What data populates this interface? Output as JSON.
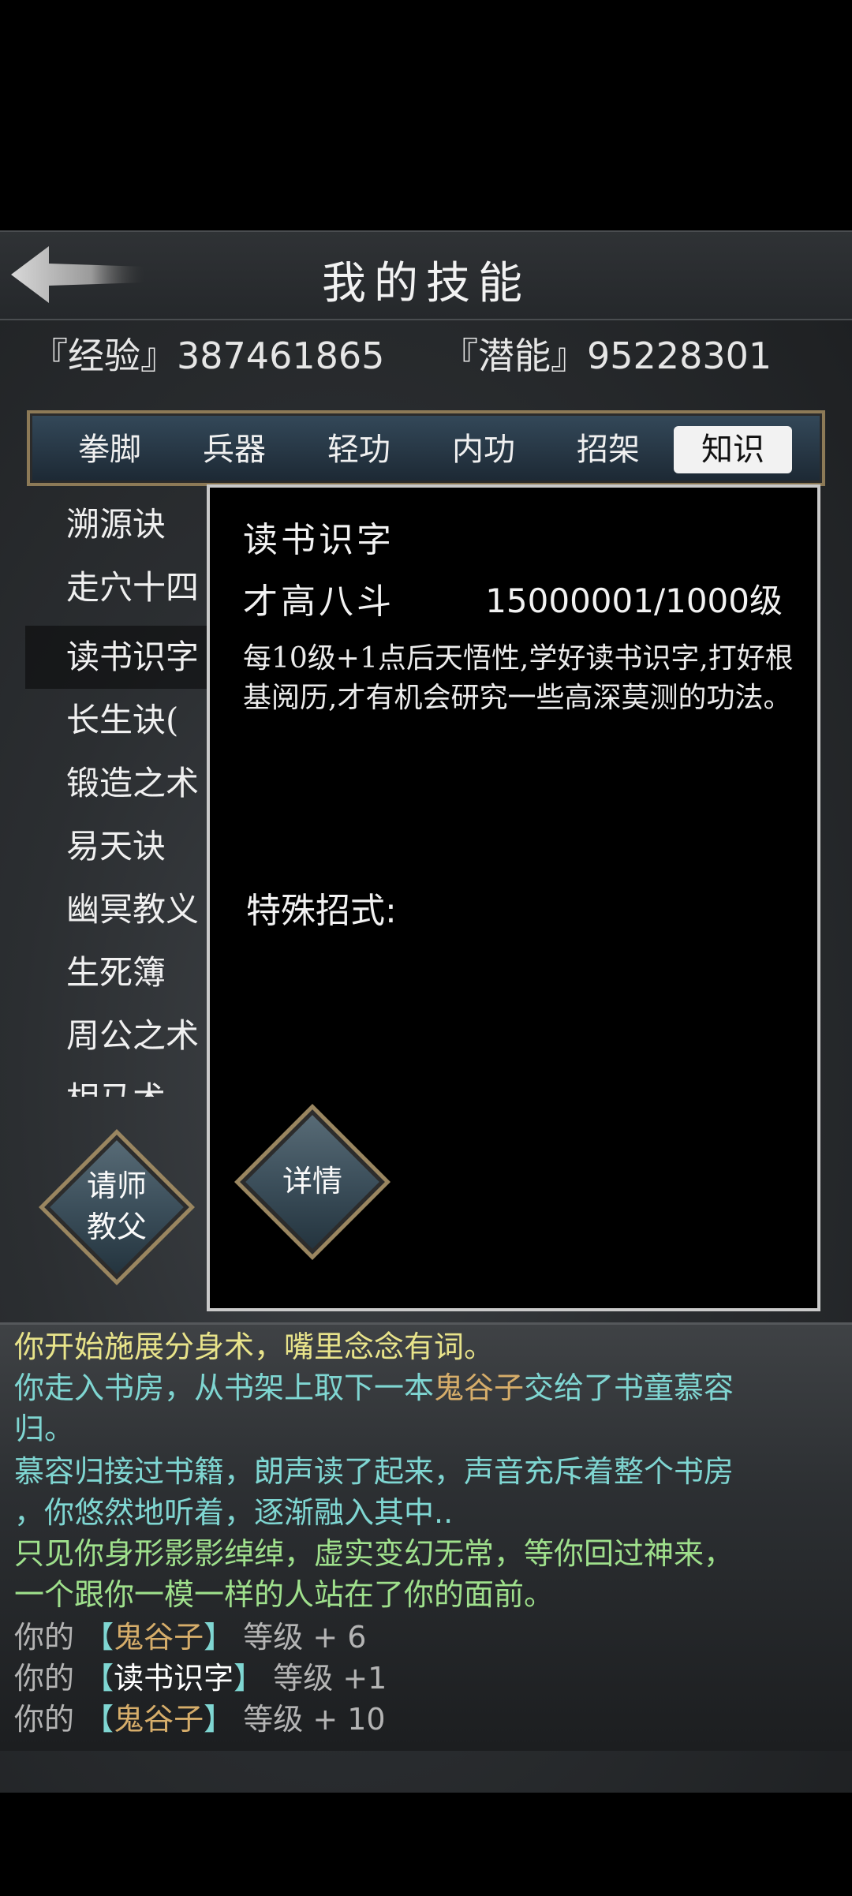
{
  "header": {
    "title": "我的技能",
    "back_icon": "back-arrow-icon"
  },
  "stats": {
    "exp": "『经验』387461865",
    "potential": "『潜能』95228301"
  },
  "tabs": [
    {
      "label": "拳脚",
      "active": false
    },
    {
      "label": "兵器",
      "active": false
    },
    {
      "label": "轻功",
      "active": false
    },
    {
      "label": "内功",
      "active": false
    },
    {
      "label": "招架",
      "active": false
    },
    {
      "label": "知识",
      "active": true
    }
  ],
  "skills": [
    {
      "label": "溯源诀"
    },
    {
      "label": "走穴十四"
    },
    {
      "label": "读书识字",
      "selected": true
    },
    {
      "label": "长生诀("
    },
    {
      "label": "锻造之术"
    },
    {
      "label": "易天诀"
    },
    {
      "label": "幽冥教义"
    },
    {
      "label": "生死簿"
    },
    {
      "label": "周公之术"
    },
    {
      "label": "相马术"
    }
  ],
  "detail": {
    "name": "读书识字",
    "rank": "才高八斗",
    "level": "15000001/1000级",
    "description": "每10级+1点后天悟性,学好读书识字,打好根基阅历,才有机会研究一些高深莫测的功法。",
    "special_label": "特殊招式:",
    "details_button": "详情"
  },
  "teacher_button": {
    "line1": "请师",
    "line2": "教父"
  },
  "log": {
    "l1": "你开始施展分身术，嘴里念念有词。",
    "l2a": "你走入书房，从书架上取下一本",
    "l2b": "鬼谷子",
    "l2c": "交给了书童慕容",
    "l3": "归。",
    "l4": "慕容归接过书籍，朗声读了起来，声音充斥着整个书房",
    "l5": "，你悠然地听着，逐渐融入其中..",
    "l6": "只见你身形影影绰绰，虚实变幻无常，等你回过神来，",
    "l7": "一个跟你一模一样的人站在了你的面前。",
    "r1_prefix": "你的",
    "r1_open": "【",
    "r1_skill": "鬼谷子",
    "r1_close": "】",
    "r1_suffix": "等级 + 6",
    "r2_prefix": "你的",
    "r2_open": "【",
    "r2_skill": "读书识字",
    "r2_close": "】",
    "r2_suffix": "等级 +1",
    "r3_prefix": "你的",
    "r3_open": "【",
    "r3_skill": "鬼谷子",
    "r3_close": "】",
    "r3_suffix": "等级 + 10"
  },
  "colors": {
    "yellow": "#e8e38a",
    "cyan": "#7fd6d2",
    "green": "#9fe08c",
    "gold": "#d6ad6a",
    "gray": "#b4b4b4"
  }
}
